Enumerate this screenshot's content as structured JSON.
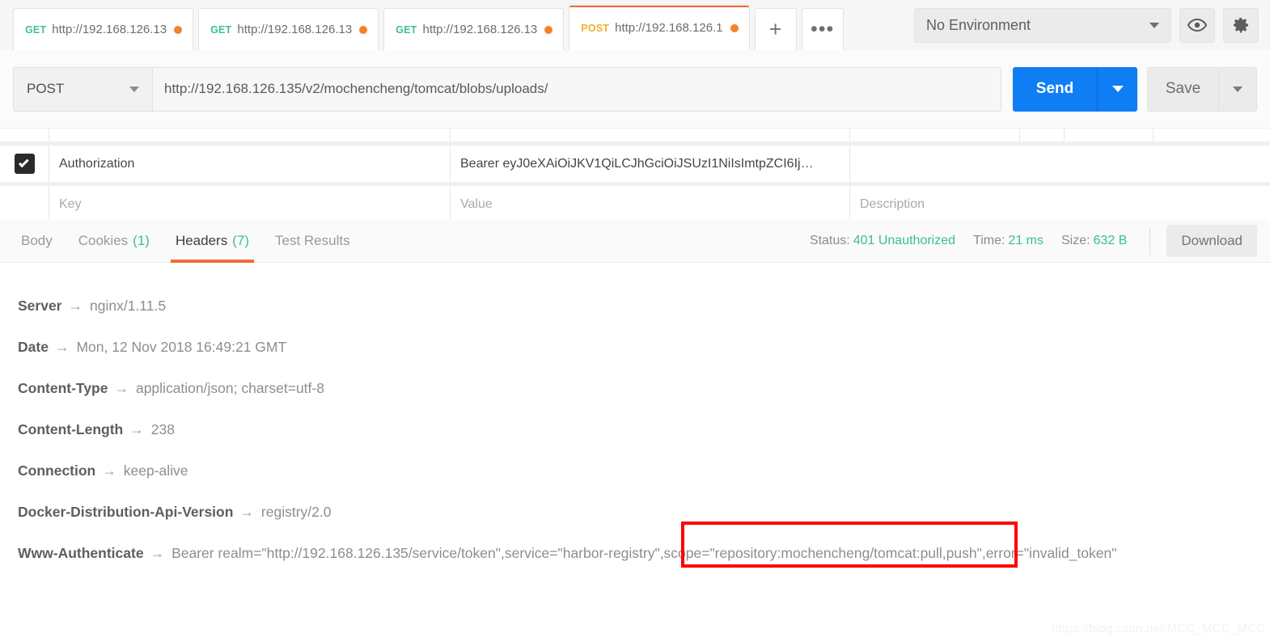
{
  "tabs": [
    {
      "method": "GET",
      "url": "http://192.168.126.13",
      "unsaved": true,
      "active": false
    },
    {
      "method": "GET",
      "url": "http://192.168.126.13",
      "unsaved": true,
      "active": false
    },
    {
      "method": "GET",
      "url": "http://192.168.126.13",
      "unsaved": true,
      "active": false
    },
    {
      "method": "POST",
      "url": "http://192.168.126.1",
      "unsaved": true,
      "active": true
    }
  ],
  "tab_actions": {
    "new_tab_label": "+",
    "new_tab_icon": "plus-icon",
    "more_label": "•••",
    "more_icon": "ellipsis-icon"
  },
  "environment": {
    "selected": "No Environment",
    "eye_icon": "eye-icon",
    "gear_icon": "gear-icon"
  },
  "request": {
    "method": "POST",
    "url": "http://192.168.126.135/v2/mochencheng/tomcat/blobs/uploads/",
    "send_label": "Send",
    "save_label": "Save"
  },
  "headers_table": {
    "columns": [
      "Key",
      "Value",
      "Description"
    ],
    "rows": [
      {
        "checked": true,
        "key": "Authorization",
        "value": "Bearer eyJ0eXAiOiJKV1QiLCJhGciOiJSUzI1NiIsImtpZCI6Ij…",
        "description": ""
      }
    ],
    "placeholder_row": {
      "key": "Key",
      "value": "Value",
      "description": "Description"
    }
  },
  "response": {
    "tabs": [
      {
        "label": "Body",
        "count": "",
        "active": false
      },
      {
        "label": "Cookies",
        "count": "(1)",
        "active": false
      },
      {
        "label": "Headers",
        "count": "(7)",
        "active": true
      },
      {
        "label": "Test Results",
        "count": "",
        "active": false
      }
    ],
    "meta": {
      "status_label": "Status:",
      "status_value": "401 Unauthorized",
      "time_label": "Time:",
      "time_value": "21 ms",
      "size_label": "Size:",
      "size_value": "632 B",
      "download_label": "Download"
    },
    "headers": [
      {
        "name": "Server",
        "value": "nginx/1.11.5"
      },
      {
        "name": "Date",
        "value": "Mon, 12 Nov 2018 16:49:21 GMT"
      },
      {
        "name": "Content-Type",
        "value": "application/json; charset=utf-8"
      },
      {
        "name": "Content-Length",
        "value": "238"
      },
      {
        "name": "Connection",
        "value": "keep-alive"
      },
      {
        "name": "Docker-Distribution-Api-Version",
        "value": "registry/2.0"
      },
      {
        "name": "Www-Authenticate",
        "value": "Bearer realm=\"http://192.168.126.135/service/token\",service=\"harbor-registry\",scope=\"repository:mochencheng/tomcat:pull,push\",error=\"invalid_token\""
      }
    ],
    "arrow": "→"
  },
  "annotation": {
    "highlighted_text": "scope=\"repository:mochencheng/tomcat:pull,push\"",
    "color": "#fe0000"
  },
  "watermark": "https://blog.csdn.net/MCC_MCC_MCC",
  "colors": {
    "accent_orange": "#f26b3a",
    "send_blue": "#0f7ef4",
    "status_green": "#3abf8d",
    "get_green": "#3ec18f",
    "post_yellow": "#f3b229",
    "unsaved_dot": "#f58228"
  }
}
